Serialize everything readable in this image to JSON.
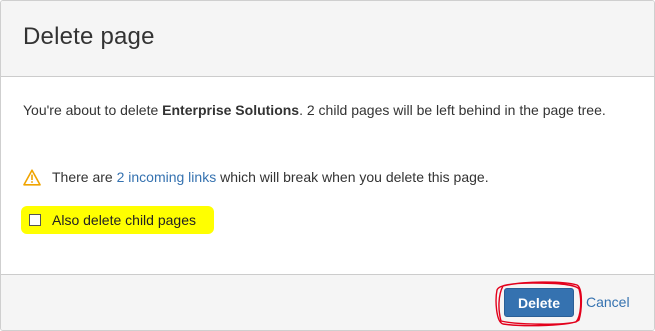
{
  "dialog": {
    "title": "Delete page"
  },
  "body": {
    "message_prefix": "You're about to delete ",
    "page_name": "Enterprise Solutions",
    "message_suffix": ". 2 child pages will be left behind in the page tree.",
    "warning_prefix": "There are ",
    "warning_link": "2 incoming links",
    "warning_suffix": " which will break when you delete this page.",
    "warning_icon": "warning-triangle-icon",
    "checkbox_label": "Also delete child pages",
    "checkbox_checked": false,
    "highlight_color": "#ffff00"
  },
  "footer": {
    "delete_label": "Delete",
    "cancel_label": "Cancel"
  },
  "colors": {
    "primary": "#3572b0",
    "link": "#3572b0",
    "annotation_circle": "#e3001b"
  }
}
